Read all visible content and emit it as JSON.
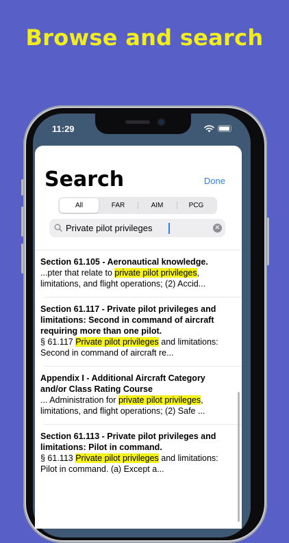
{
  "promo": {
    "headline": "Browse and search"
  },
  "status_bar": {
    "time": "11:29"
  },
  "screen": {
    "title": "Search",
    "done_label": "Done",
    "segments": [
      {
        "label": "All",
        "selected": true
      },
      {
        "label": "FAR",
        "selected": false
      },
      {
        "label": "AIM",
        "selected": false
      },
      {
        "label": "PCG",
        "selected": false
      }
    ],
    "search": {
      "value": "Private pilot privileges"
    }
  },
  "results": [
    {
      "title": "Section 61.105 - Aeronautical knowledge.",
      "snippet_before": "...pter that relate to ",
      "highlight": "private pilot privileges",
      "snippet_after": ", limitations, and flight operations;   (2) Accid..."
    },
    {
      "title": "Section 61.117 - Private pilot privileges and limitations: Second in command of aircraft requiring more than one pilot.",
      "snippet_before": "§ 61.117 ",
      "highlight": "Private pilot privileges",
      "snippet_after": " and limitations: Second in command of aircraft re..."
    },
    {
      "title": "Appendix I - Additional Aircraft Category and/or Class Rating Course",
      "snippet_before": "... Administration for ",
      "highlight": "private pilot privileges",
      "snippet_after": ", limitations, and flight operations;   (2) Safe ..."
    },
    {
      "title": "Section 61.113 - Private pilot privileges and limitations: Pilot in command.",
      "snippet_before": "§ 61.113 ",
      "highlight": "Private pilot privileges",
      "snippet_after": " and limitations: Pilot in command.  (a) Except a..."
    }
  ],
  "colors": {
    "background": "#5860c8",
    "headline": "#f2ee1e",
    "accent": "#2f7ce8",
    "highlight": "#f5f21a"
  },
  "icons": [
    "search-icon",
    "clear-icon",
    "wifi-icon",
    "battery-icon"
  ]
}
